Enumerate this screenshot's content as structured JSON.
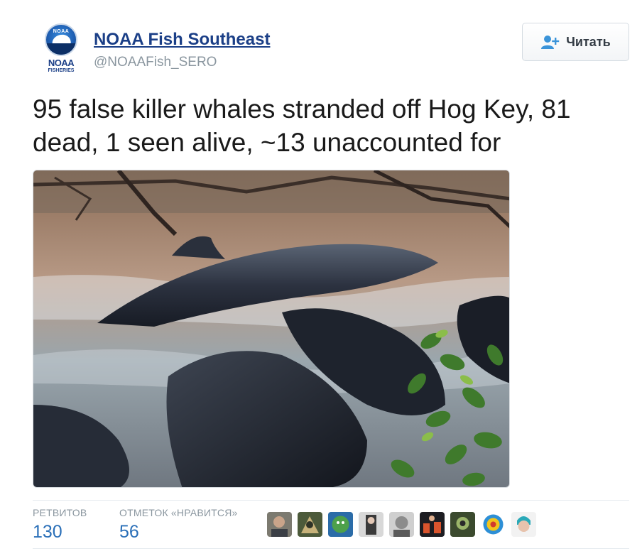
{
  "account": {
    "name": "NOAA Fish Southeast",
    "handle": "@NOAAFish_SERO",
    "avatar_line1": "NOAA",
    "avatar_line2": "FISHERIES",
    "avatar_badge": "NOAA"
  },
  "follow_button": {
    "label": "Читать",
    "icon": "add-user-icon"
  },
  "tweet": {
    "text": "95 false killer whales stranded off Hog Key, 81 dead, 1 seen alive, ~13 unaccounted for"
  },
  "stats": {
    "retweets_label": "РЕТВИТОВ",
    "retweets_value": "130",
    "likes_label": "ОТМЕТОК «НРАВИТСЯ»",
    "likes_value": "56"
  },
  "colors": {
    "brand_blue": "#1b3f87",
    "link_blue": "#2a6fb8",
    "muted_gray": "#8a969f"
  }
}
